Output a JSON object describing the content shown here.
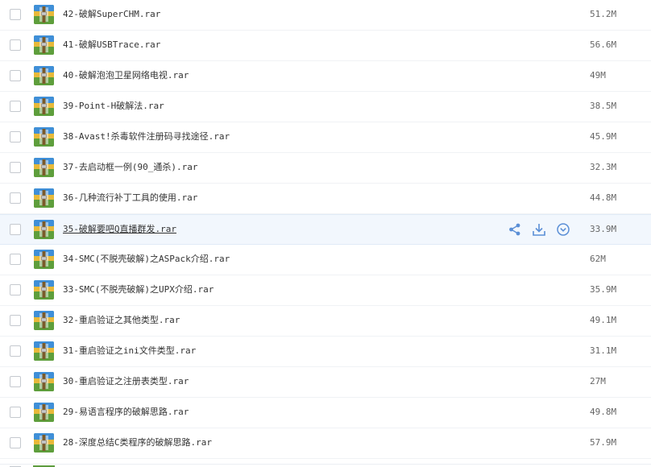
{
  "files": [
    {
      "name": "42-破解SuperCHM.rar",
      "size": "51.2M"
    },
    {
      "name": "41-破解USBTrace.rar",
      "size": "56.6M"
    },
    {
      "name": "40-破解泡泡卫星网络电视.rar",
      "size": "49M"
    },
    {
      "name": "39-Point-H破解法.rar",
      "size": "38.5M"
    },
    {
      "name": "38-Avast!杀毒软件注册码寻找途径.rar",
      "size": "45.9M"
    },
    {
      "name": "37-去启动框一例(90_通杀).rar",
      "size": "32.3M"
    },
    {
      "name": "36-几种流行补丁工具的使用.rar",
      "size": "44.8M"
    },
    {
      "name": "35-破解要吧Q直播群发.rar",
      "size": "33.9M"
    },
    {
      "name": "34-SMC(不脱壳破解)之ASPack介绍.rar",
      "size": "62M"
    },
    {
      "name": "33-SMC(不脱壳破解)之UPX介绍.rar",
      "size": "35.9M"
    },
    {
      "name": "32-重启验证之其他类型.rar",
      "size": "49.1M"
    },
    {
      "name": "31-重启验证之ini文件类型.rar",
      "size": "31.1M"
    },
    {
      "name": "30-重启验证之注册表类型.rar",
      "size": "27M"
    },
    {
      "name": "29-易语言程序的破解思路.rar",
      "size": "49.8M"
    },
    {
      "name": "28-深度总结C类程序的破解思路.rar",
      "size": "57.9M"
    }
  ],
  "hovered_index": 7,
  "row_actions": {
    "share_icon": "share-icon",
    "download_icon": "download-icon",
    "more_icon": "chevron-down-circle-icon"
  },
  "colors": {
    "hover_bg": "#f2f7fd",
    "icon_blue": "#5b8fd6"
  }
}
